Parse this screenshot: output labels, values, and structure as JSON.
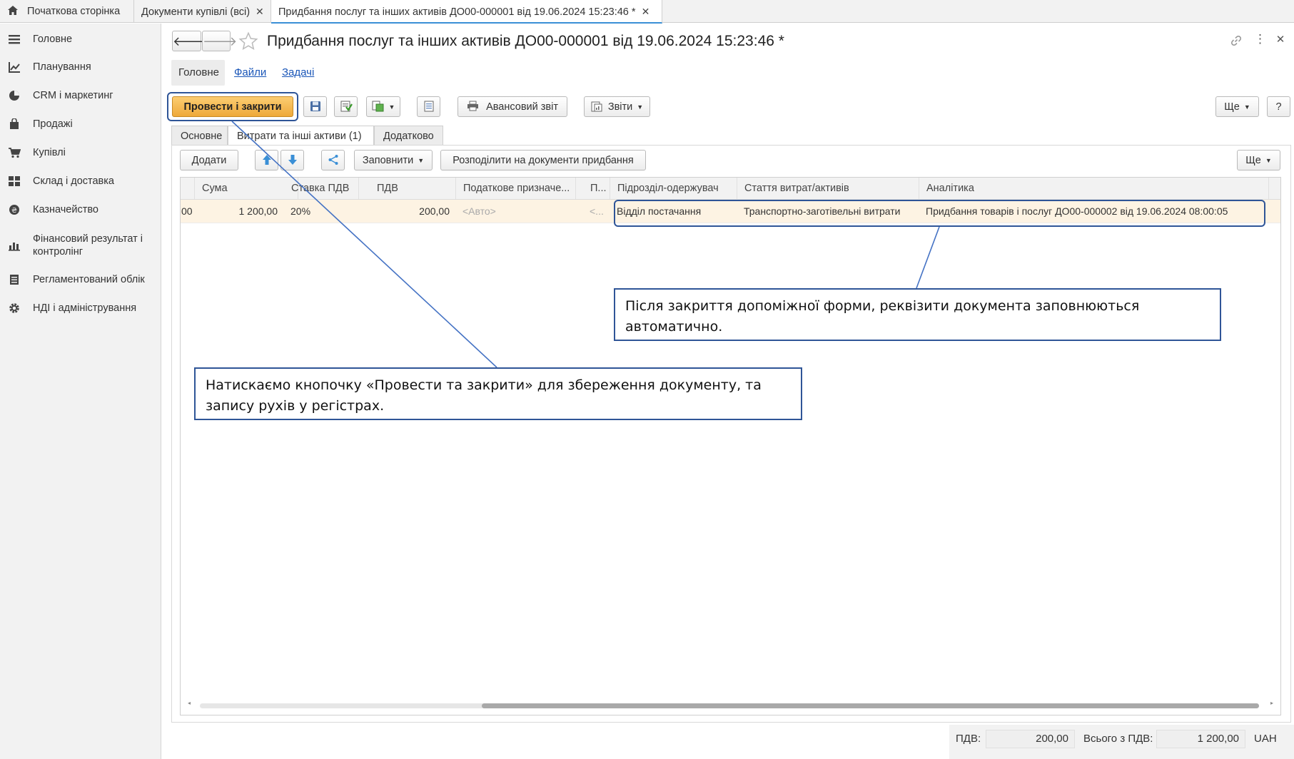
{
  "tabs": [
    {
      "label": "Початкова сторінка"
    },
    {
      "label": "Документи купівлі (всі)"
    },
    {
      "label": "Придбання послуг та інших активів ДО00-000001 від 19.06.2024 15:23:46 *"
    }
  ],
  "sidebar": {
    "items": [
      {
        "label": "Головне"
      },
      {
        "label": "Планування"
      },
      {
        "label": "CRM і маркетинг"
      },
      {
        "label": "Продажі"
      },
      {
        "label": "Купівлі"
      },
      {
        "label": "Склад і доставка"
      },
      {
        "label": "Казначейство"
      },
      {
        "label": "Фінансовий результат і контролінг"
      },
      {
        "label": "Регламентований облік"
      },
      {
        "label": "НДІ і адміністрування"
      }
    ]
  },
  "document": {
    "title": "Придбання послуг та інших активів ДО00-000001 від 19.06.2024 15:23:46 *",
    "subnav": [
      "Головне",
      "Файли",
      "Задачі"
    ]
  },
  "toolbar": {
    "post_close": "Провести і закрити",
    "advance_report": "Авансовий звіт",
    "reports": "Звіти",
    "more": "Ще",
    "help": "?"
  },
  "form_tabs": [
    "Основне",
    "Витрати та інші активи (1)",
    "Додатково"
  ],
  "table_toolbar": {
    "add": "Додати",
    "fill": "Заповнити",
    "distribute": "Розподілити на документи придбання",
    "more": "Ще"
  },
  "table": {
    "columns": [
      "Сума",
      "Ставка ПДВ",
      "ПДВ",
      "Податкове призначе...",
      "П...",
      "Підрозділ-одержувач",
      "Стаття витрат/активів",
      "Аналітика"
    ],
    "rows": [
      {
        "cut": "00",
        "sum": "1 200,00",
        "vat_rate": "20%",
        "vat": "200,00",
        "tax_purpose": "<Авто>",
        "p": "<...",
        "department": "Відділ постачання",
        "expense_item": "Транспортно-заготівельні витрати",
        "analytics": "Придбання товарів і послуг ДО00-000002 від 19.06.2024 08:00:05"
      }
    ]
  },
  "notes": {
    "auto_fill": "Після закриття допоміжної форми, реквізити документа заповнюються автоматично.",
    "post_close": "Натискаємо кнопочку «Провести та закрити» для збереження документу, та запису рухів у регістрах."
  },
  "footer": {
    "vat_label": "ПДВ:",
    "vat_value": "200,00",
    "total_label": "Всього з ПДВ:",
    "total_value": "1 200,00",
    "currency": "UAH"
  },
  "colors": {
    "accent": "#3a8fd6",
    "primary_button": "#f5b94a",
    "annotation": "#2f5597",
    "row_highlight": "#fdf3e3"
  }
}
